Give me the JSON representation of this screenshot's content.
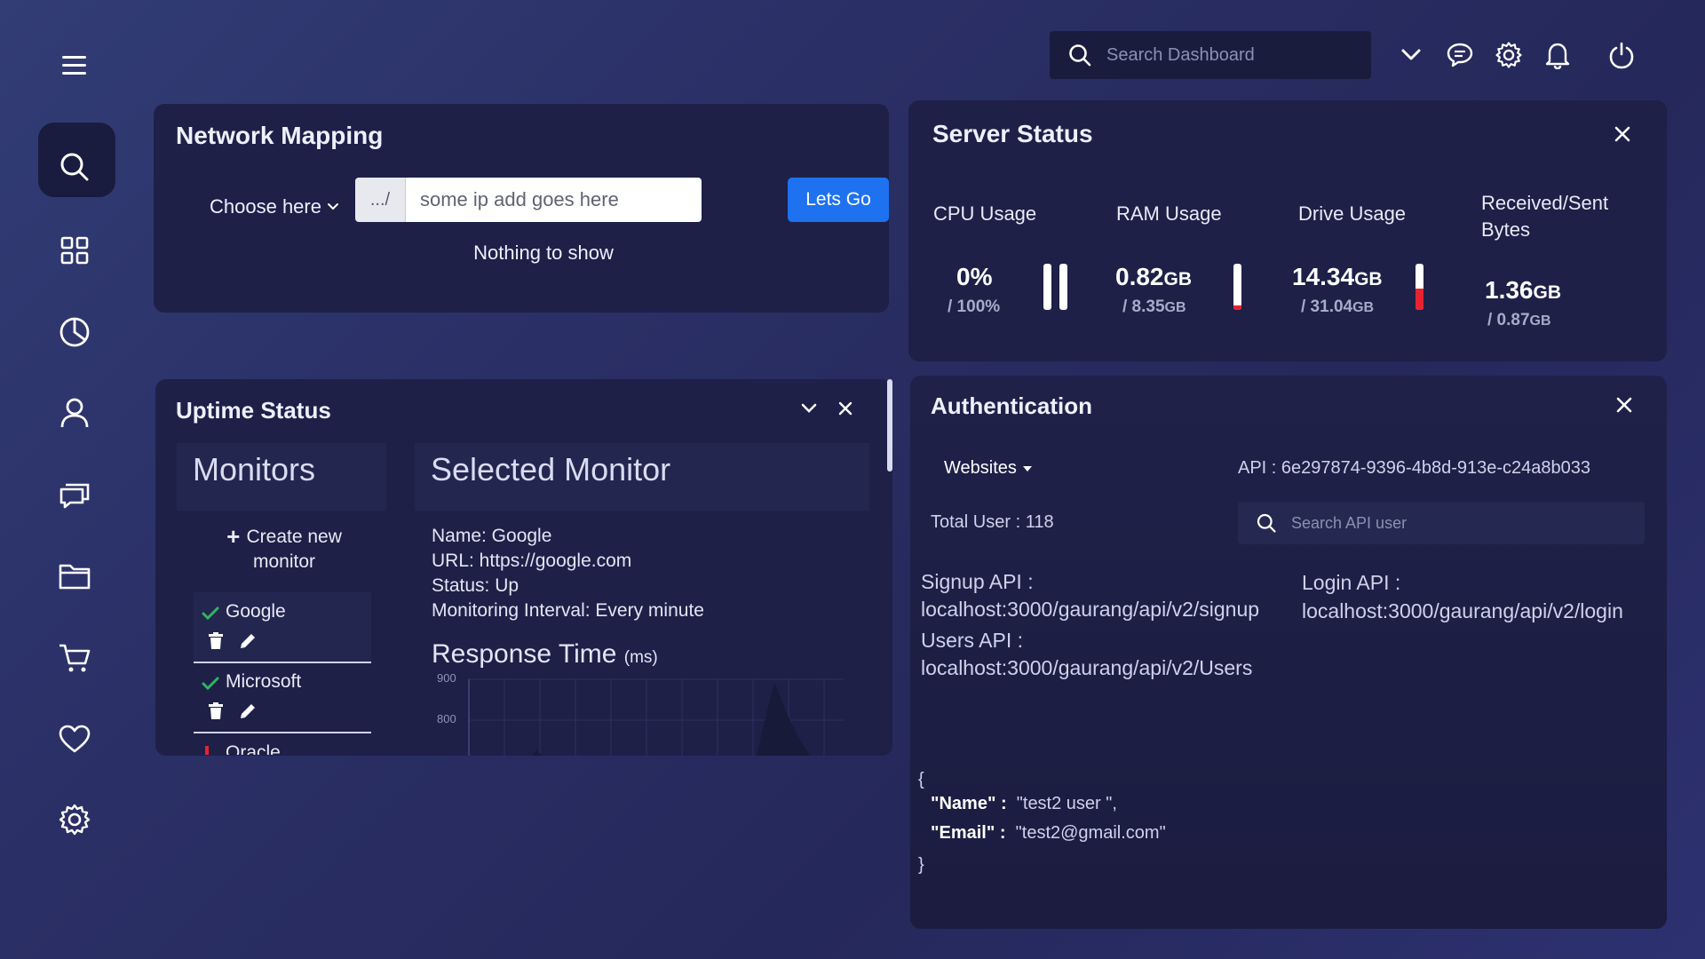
{
  "top": {
    "search_placeholder": "Search Dashboard"
  },
  "sidebar": {
    "items": [
      {
        "icon": "search-icon",
        "active": true
      },
      {
        "icon": "grid-icon"
      },
      {
        "icon": "pie-chart-icon"
      },
      {
        "icon": "user-icon"
      },
      {
        "icon": "chat-icon"
      },
      {
        "icon": "folder-icon"
      },
      {
        "icon": "cart-icon"
      },
      {
        "icon": "heart-icon"
      },
      {
        "icon": "settings-icon"
      }
    ]
  },
  "network": {
    "title": "Network Mapping",
    "choose_label": "Choose here",
    "prefix": ".../",
    "ip_placeholder": "some ip add goes here",
    "go_label": "Lets Go",
    "empty_text": "Nothing to show"
  },
  "server": {
    "title": "Server Status",
    "metrics": [
      {
        "label": "CPU Usage",
        "value": "0%",
        "max": "/ 100%",
        "fill": 0
      },
      {
        "label": "RAM Usage",
        "value": "0.82",
        "unit": "GB",
        "max": "/ 8.35",
        "max_unit": "GB",
        "fill": 0.1
      },
      {
        "label": "Drive Usage",
        "value": "14.34",
        "unit": "GB",
        "max": "/ 31.04",
        "max_unit": "GB",
        "fill": 0.46
      },
      {
        "label": "Received/Sent Bytes",
        "value": "1.36",
        "unit": "GB",
        "max": "/ 0.87",
        "max_unit": "GB"
      }
    ]
  },
  "uptime": {
    "title": "Uptime Status",
    "monitors_heading": "Monitors",
    "selected_heading": "Selected Monitor",
    "create_label": "Create new monitor",
    "monitors": [
      {
        "name": "Google",
        "status": "up"
      },
      {
        "name": "Microsoft",
        "status": "up"
      },
      {
        "name": "Oracle",
        "status": "down"
      }
    ],
    "selected": {
      "name": "Name: Google",
      "url": "URL: https://google.com",
      "status": "Status: Up",
      "interval": "Monitoring Interval: Every minute"
    },
    "response_title": "Response Time",
    "response_unit": "(ms)",
    "y_ticks": [
      "900",
      "800"
    ]
  },
  "auth": {
    "title": "Authentication",
    "dropdown": "Websites",
    "api_key": "API : 6e297874-9396-4b8d-913e-c24a8b033",
    "total_users": "Total User : 118",
    "search_placeholder": "Search API user",
    "signup_label": "Signup API :",
    "signup_url": "localhost:3000/gaurang/api/v2/signup",
    "login_label": "Login API :",
    "login_url": "localhost:3000/gaurang/api/v2/login",
    "users_label": "Users API :",
    "users_url": "localhost:3000/gaurang/api/v2/Users",
    "json_open": "{",
    "json_name_key": "\"Name\" :",
    "json_name_val": "\"test2 user \",",
    "json_email_key": "\"Email\" :",
    "json_email_val": "\"test2@gmail.com\"",
    "json_close": "}"
  },
  "colors": {
    "accent": "#1e72f0",
    "panel": "#1e2048",
    "status_up": "#2fb560",
    "status_down": "#e8232f"
  }
}
